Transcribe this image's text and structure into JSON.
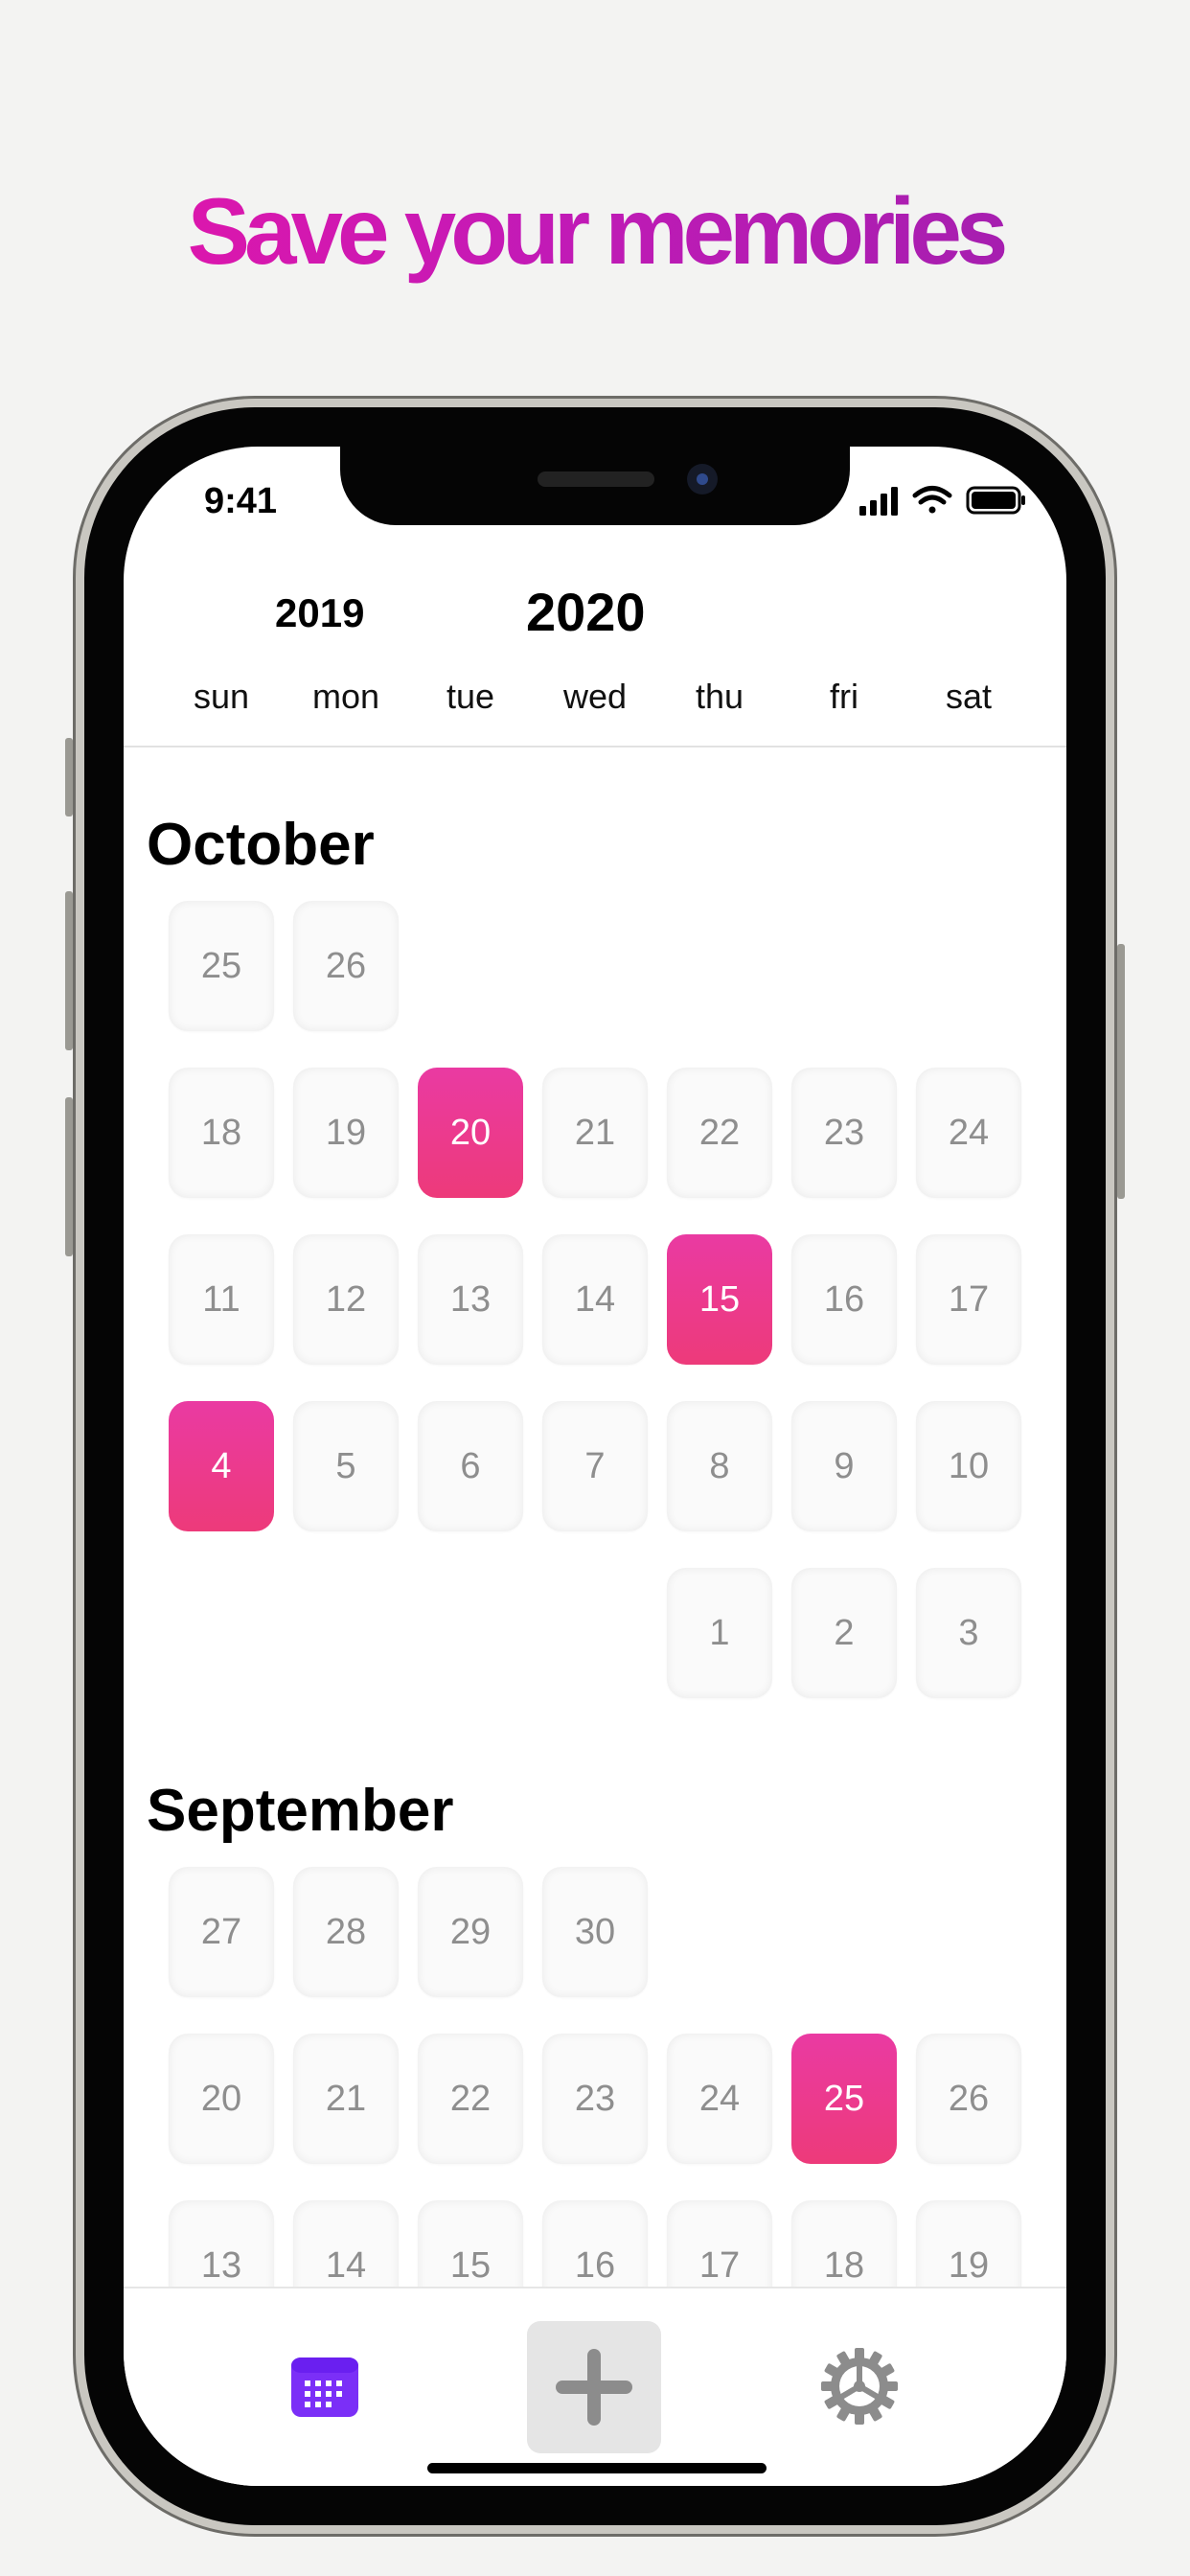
{
  "headline": "Save your memories",
  "status": {
    "time": "9:41"
  },
  "calendar_header": {
    "prev_year": "2019",
    "current_year": "2020",
    "weekdays": [
      "sun",
      "mon",
      "tue",
      "wed",
      "thu",
      "fri",
      "sat"
    ]
  },
  "months": [
    {
      "name": "October",
      "weeks": [
        [
          {
            "day": "25",
            "marked": false
          },
          {
            "day": "26",
            "marked": false
          },
          null,
          null,
          null,
          null,
          null
        ],
        [
          {
            "day": "18",
            "marked": false
          },
          {
            "day": "19",
            "marked": false
          },
          {
            "day": "20",
            "marked": true
          },
          {
            "day": "21",
            "marked": false
          },
          {
            "day": "22",
            "marked": false
          },
          {
            "day": "23",
            "marked": false
          },
          {
            "day": "24",
            "marked": false
          }
        ],
        [
          {
            "day": "11",
            "marked": false
          },
          {
            "day": "12",
            "marked": false
          },
          {
            "day": "13",
            "marked": false
          },
          {
            "day": "14",
            "marked": false
          },
          {
            "day": "15",
            "marked": true
          },
          {
            "day": "16",
            "marked": false
          },
          {
            "day": "17",
            "marked": false
          }
        ],
        [
          {
            "day": "4",
            "marked": true
          },
          {
            "day": "5",
            "marked": false
          },
          {
            "day": "6",
            "marked": false
          },
          {
            "day": "7",
            "marked": false
          },
          {
            "day": "8",
            "marked": false
          },
          {
            "day": "9",
            "marked": false
          },
          {
            "day": "10",
            "marked": false
          }
        ],
        [
          null,
          null,
          null,
          null,
          {
            "day": "1",
            "marked": false
          },
          {
            "day": "2",
            "marked": false
          },
          {
            "day": "3",
            "marked": false
          }
        ]
      ]
    },
    {
      "name": "September",
      "weeks": [
        [
          {
            "day": "27",
            "marked": false
          },
          {
            "day": "28",
            "marked": false
          },
          {
            "day": "29",
            "marked": false
          },
          {
            "day": "30",
            "marked": false
          },
          null,
          null,
          null
        ],
        [
          {
            "day": "20",
            "marked": false
          },
          {
            "day": "21",
            "marked": false
          },
          {
            "day": "22",
            "marked": false
          },
          {
            "day": "23",
            "marked": false
          },
          {
            "day": "24",
            "marked": false
          },
          {
            "day": "25",
            "marked": true
          },
          {
            "day": "26",
            "marked": false
          }
        ],
        [
          {
            "day": "13",
            "marked": false
          },
          {
            "day": "14",
            "marked": false
          },
          {
            "day": "15",
            "marked": false
          },
          {
            "day": "16",
            "marked": false
          },
          {
            "day": "17",
            "marked": false
          },
          {
            "day": "18",
            "marked": false
          },
          {
            "day": "19",
            "marked": false
          }
        ]
      ]
    }
  ],
  "tabbar": {
    "items": [
      {
        "name": "calendar",
        "icon": "calendar-icon",
        "selected": true
      },
      {
        "name": "add",
        "icon": "plus-icon",
        "selected": false
      },
      {
        "name": "settings",
        "icon": "gear-icon",
        "selected": false
      }
    ]
  },
  "colors": {
    "accent": "#7b2ff7",
    "marked_day": "#eb3a8f",
    "headline_gradient": [
      "#e815a8",
      "#9b20ad"
    ]
  }
}
